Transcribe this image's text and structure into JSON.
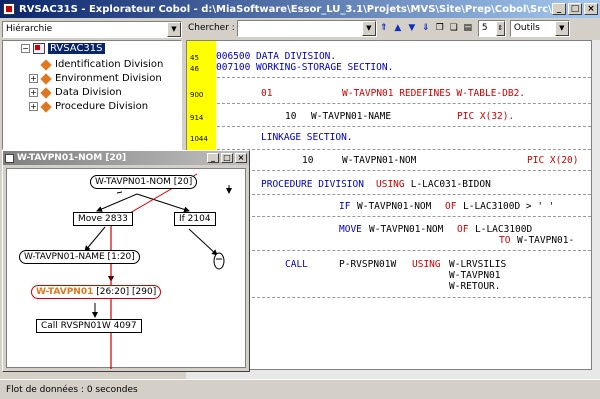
{
  "window": {
    "title": "RVSAC31S - Explorateur Cobol - d:\\MiaSoftware\\Essor_LU_3.1\\Projets\\MVS\\Site\\Prep\\Cobol\\Src\\RVSAC31S"
  },
  "leftpanel": {
    "view_select": "Hiérarchie",
    "root": "RVSAC31S",
    "items": [
      "Identification Division",
      "Environment Division",
      "Data Division",
      "Procedure Division"
    ]
  },
  "toolbar": {
    "search_label": "Chercher :",
    "search_value": "",
    "level_value": "5",
    "tools_select": "Outils"
  },
  "code": {
    "lines": [
      {
        "num": "45",
        "text": "006500 DATA DIVISION."
      },
      {
        "num": "46",
        "text": "007100 WORKING-STORAGE SECTION."
      },
      {
        "num": "900",
        "lvl": "01",
        "text": "W-TAVPN01 REDEFINES W-TABLE-DB2."
      },
      {
        "num": "914",
        "lvl": "10",
        "name": "W-TAVPN01-NAME",
        "pic": "PIC X(32)."
      },
      {
        "num": "1044",
        "text": "LINKAGE SECTION."
      },
      {
        "lvl": "10",
        "name": "W-TAVPN01-NOM",
        "pic": "PIC X(20)"
      },
      {
        "text1": "PROCEDURE DIVISION ",
        "kw": "USING",
        "text2": " L-LAC031-BIDON"
      },
      {
        "kw1": "IF",
        "name": "W-TAVPN01-NOM",
        "kw2": "OF",
        "rest": "L-LAC3100D > ' '"
      },
      {
        "kw1": "MOVE",
        "name": "W-TAVPN01-NOM",
        "kw2": "OF",
        "rest": "L-LAC3100D",
        "kw3": "TO",
        "rest2": "W-TAVPN01-"
      },
      {
        "kw1": "CALL",
        "name": "P-RVSPN01W",
        "kw2": "USING",
        "args": [
          "W-LRVSILIS",
          "W-TAVPN01",
          "W-RETOUR."
        ]
      }
    ]
  },
  "graph": {
    "title": "W-TAVPN01-NOM [20]",
    "nodes": {
      "root": "W-TAVPN01-NOM [20]",
      "move": "Move 2833",
      "if": "If 2104",
      "name": "W-TAVPN01-NAME [1:20]",
      "tav_hl": "W-TAVPN01",
      "tav_rest": " [26:20] [290]",
      "call": "Call RVSPN01W 4097"
    }
  },
  "status": {
    "text": "Flot de données : 0 secondes"
  }
}
